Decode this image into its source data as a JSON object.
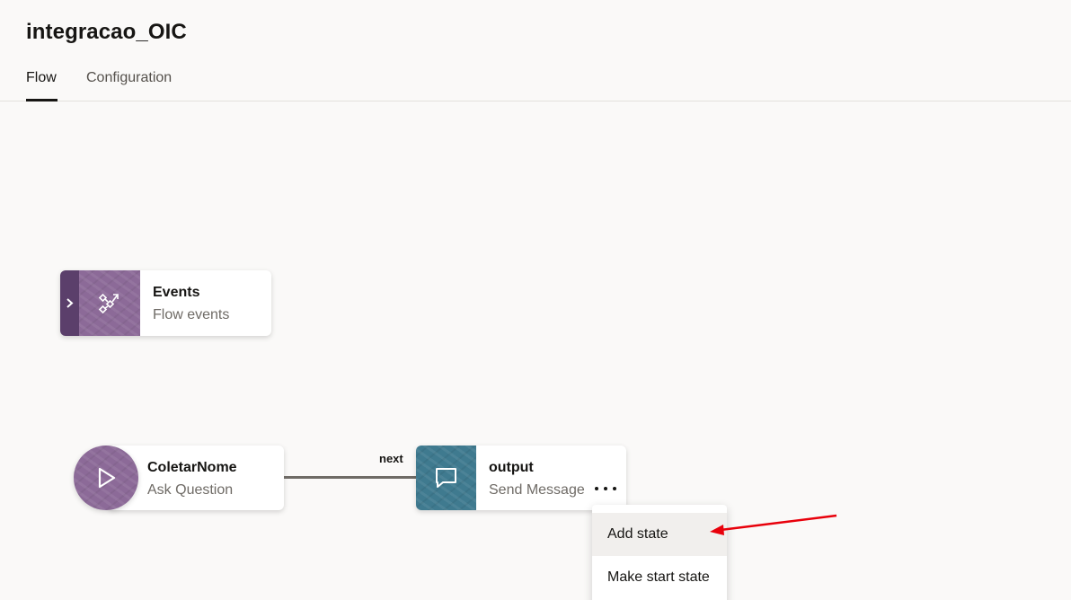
{
  "header": {
    "title": "integracao_OIC"
  },
  "tabs": [
    {
      "label": "Flow",
      "active": true
    },
    {
      "label": "Configuration",
      "active": false
    }
  ],
  "flow": {
    "events_node": {
      "title": "Events",
      "subtitle": "Flow events"
    },
    "states": [
      {
        "title": "ColetarNome",
        "subtitle": "Ask Question",
        "icon": "play-icon"
      },
      {
        "title": "output",
        "subtitle": "Send Message",
        "icon": "chat-bubble-icon"
      }
    ],
    "transition_label": "next"
  },
  "context_menu": {
    "items": [
      {
        "label": "Add state",
        "hovered": true
      },
      {
        "label": "Make start state"
      }
    ]
  },
  "colors": {
    "events_accent": "#5b3f6b",
    "ask_node": "#8c6a98",
    "message_node": "#3f7a8f",
    "annotation_arrow": "#e8000b"
  }
}
